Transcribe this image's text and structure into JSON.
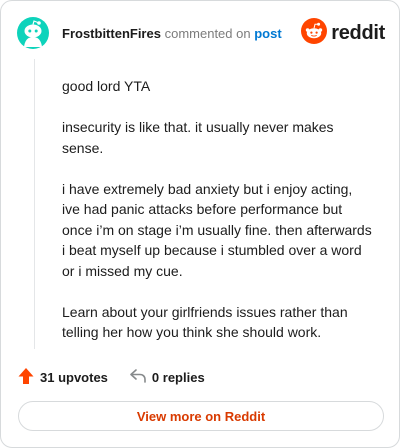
{
  "comment": {
    "author": "FrostbittenFires",
    "action_text": "commented on",
    "post_link_text": "post",
    "paragraphs": [
      "good lord YTA",
      "insecurity is like that. it usually never makes sense.",
      "i have extremely bad anxiety but i enjoy acting, ive had panic attacks before performance but once i’m on stage i’m usually fine. then afterwards i beat myself up because i stumbled over a word or i missed my cue.",
      "Learn about your girlfriends issues rather than telling her how you think she should work."
    ],
    "upvotes_label": "31 upvotes",
    "replies_label": "0 replies",
    "view_more_label": "View more on Reddit"
  },
  "brand": {
    "wordmark": "reddit",
    "accent_color": "#ff4500",
    "avatar_color": "#0dd3bb",
    "link_color": "#0079d3"
  },
  "icons": {
    "avatar": "snoo-avatar-icon",
    "logo": "reddit-logo-icon",
    "upvote": "upvote-arrow-icon",
    "reply": "reply-arrow-icon"
  }
}
